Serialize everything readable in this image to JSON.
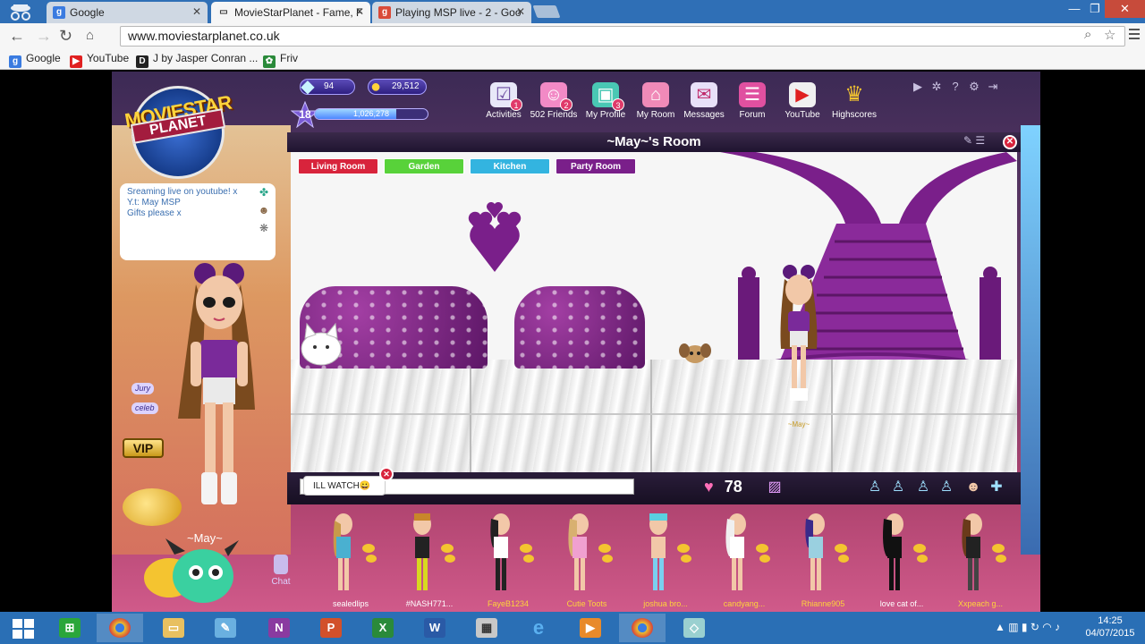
{
  "browser": {
    "tabs": [
      {
        "title": "Google",
        "favicon": "google-icon",
        "active": false
      },
      {
        "title": "MovieStarPlanet - Fame, F",
        "favicon": "msp-icon",
        "active": true
      },
      {
        "title": "Playing MSP live - 2 - Goo",
        "favicon": "googleplus-icon",
        "active": false
      }
    ],
    "url": "www.moviestarplanet.co.uk",
    "bookmarks": [
      {
        "label": "Google",
        "icon": "google-icon"
      },
      {
        "label": "YouTube",
        "icon": "youtube-icon"
      },
      {
        "label": "J by Jasper Conran ...",
        "icon": "debenhams-icon"
      },
      {
        "label": "Friv",
        "icon": "friv-icon"
      }
    ]
  },
  "game": {
    "logo": {
      "line1": "MOVIESTAR",
      "line2": "PLANET"
    },
    "stats": {
      "diamonds": "94",
      "starcoins": "29,512",
      "level": "18",
      "fame": "1,026,278",
      "fame_progress": 0.72
    },
    "nav": [
      {
        "label": "Activities",
        "icon": "activities-icon",
        "badge": "1"
      },
      {
        "label": "502 Friends",
        "icon": "friends-icon",
        "badge": "2"
      },
      {
        "label": "My Profile",
        "icon": "profile-icon",
        "badge": "3"
      },
      {
        "label": "My Room",
        "icon": "room-icon",
        "badge": ""
      },
      {
        "label": "Messages",
        "icon": "messages-icon",
        "badge": ""
      },
      {
        "label": "Forum",
        "icon": "forum-icon",
        "badge": ""
      },
      {
        "label": "YouTube",
        "icon": "youtube-icon",
        "badge": ""
      },
      {
        "label": "Highscores",
        "icon": "trophy-icon",
        "badge": ""
      }
    ],
    "status_bubble": {
      "lines": [
        "Sreaming live on youtube! x",
        "Y.t: May MSP",
        "Gifts please x"
      ]
    },
    "tags": [
      "Jury",
      "celeb"
    ],
    "vip_label": "VIP",
    "player_name": "~May~",
    "chat_label": "Chat",
    "room": {
      "title": "~May~'s Room",
      "tabs": [
        {
          "label": "Living Room",
          "color": "#d8243c"
        },
        {
          "label": "Garden",
          "color": "#58d23a"
        },
        {
          "label": "Kitchen",
          "color": "#33b4e0"
        },
        {
          "label": "Party Room",
          "color": "#7a1f8a"
        }
      ],
      "avatar_name": "~May~",
      "chat_bubble": "ILL WATCH😀",
      "likes": "78"
    },
    "friends": [
      {
        "name": "sealedlips",
        "highlight": false
      },
      {
        "name": "#NASH771...",
        "highlight": false
      },
      {
        "name": "FayeB1234",
        "highlight": true
      },
      {
        "name": "Cutie Toots",
        "highlight": true
      },
      {
        "name": "joshua bro...",
        "highlight": true
      },
      {
        "name": "candyang...",
        "highlight": true
      },
      {
        "name": "Rhianne905",
        "highlight": true
      },
      {
        "name": "love cat of...",
        "highlight": false
      },
      {
        "name": "Xxpeach g...",
        "highlight": true
      }
    ]
  },
  "taskbar": {
    "apps": [
      "start-icon",
      "store-icon",
      "chrome-icon",
      "explorer-icon",
      "paint-icon",
      "onenote-icon",
      "powerpoint-icon",
      "excel-icon",
      "word-icon",
      "calculator-icon",
      "ie-icon",
      "media-icon",
      "chrome-icon",
      "app-icon"
    ],
    "time": "14:25",
    "date": "04/07/2015"
  }
}
